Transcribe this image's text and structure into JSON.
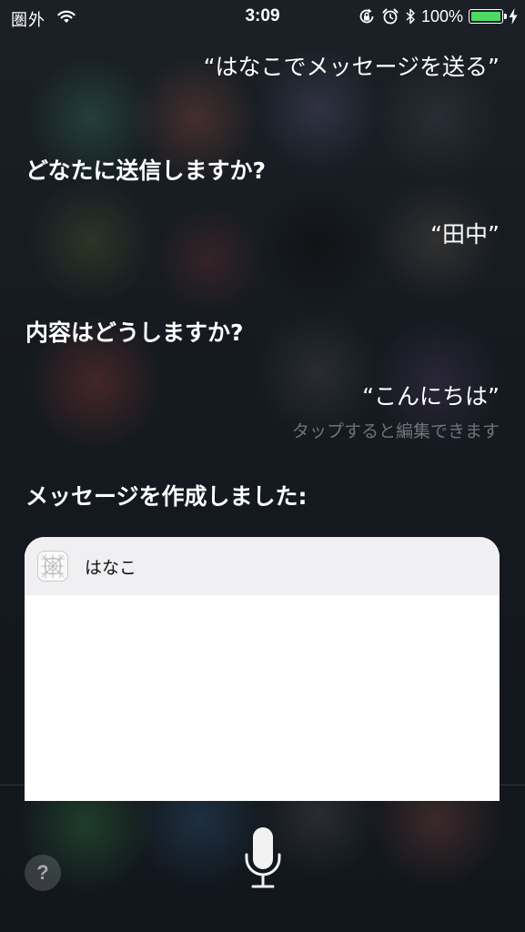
{
  "status_bar": {
    "carrier": "圏外",
    "time": "3:09",
    "battery_percent": "100%",
    "battery_level": 1.0,
    "battery_color": "#4cd964",
    "icons": [
      "wifi-icon",
      "rotation-lock-icon",
      "alarm-icon",
      "bluetooth-icon",
      "battery-icon",
      "charging-bolt-icon"
    ]
  },
  "conversation": {
    "user_command": "“はなこでメッセージを送る”",
    "siri_ask_recipient": "どなたに送信しますか?",
    "user_recipient": "“田中”",
    "siri_ask_content": "内容はどうしますか?",
    "user_content": "“こんにちは”",
    "edit_hint": "タップすると編集できます",
    "siri_result": "メッセージを作成しました:"
  },
  "message_card": {
    "app_icon": "app-grid-icon",
    "recipient": "はなこ",
    "body": ""
  },
  "bottom_bar": {
    "help_label": "?",
    "mic_icon": "microphone-icon"
  }
}
